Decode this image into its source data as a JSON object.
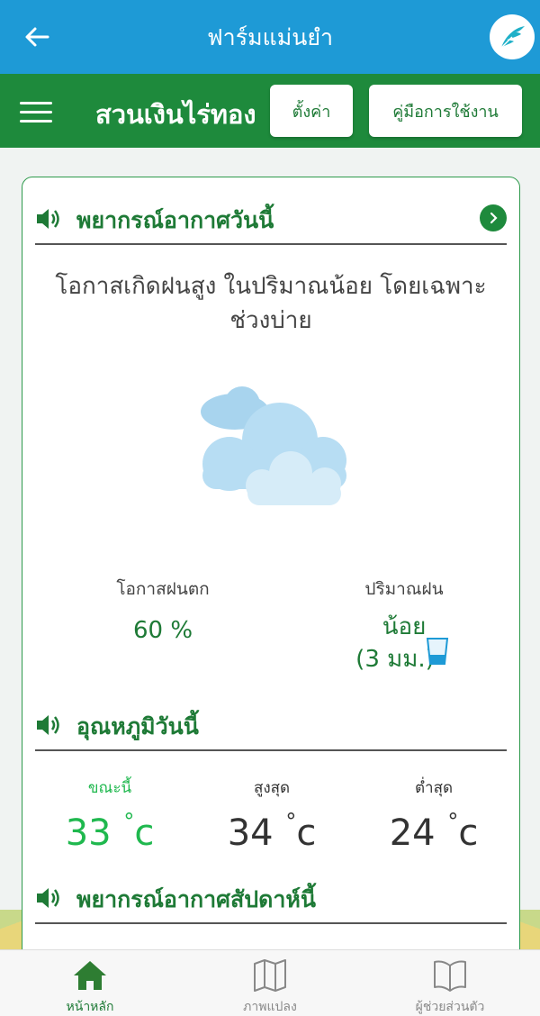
{
  "topbar": {
    "title": "ฟาร์มแม่นยำ",
    "back_icon": "arrow-left-icon",
    "logo_icon": "feather-logo-icon"
  },
  "farm_bar": {
    "name": "สวนเงินไร่ทอง",
    "settings_label": "ตั้งค่า",
    "manual_label": "คู่มือการใช้งาน"
  },
  "today_weather": {
    "title": "พยากรณ์อากาศวันนี้",
    "description": "โอกาสเกิดฝนสูง ในปริมาณน้อย โดยเฉพาะช่วงบ่าย",
    "rain_chance_label": "โอกาสฝนตก",
    "rain_chance_value": "60 %",
    "rain_amount_label": "ปริมาณฝน",
    "rain_amount_value": "น้อย",
    "rain_amount_detail": "(3 มม.)"
  },
  "temperature": {
    "title": "อุณหภูมิวันนี้",
    "now_label": "ขณะนี้",
    "now_value": "33",
    "max_label": "สูงสุด",
    "max_value": "34",
    "min_label": "ต่ำสุด",
    "min_value": "24",
    "unit": "c"
  },
  "weekly": {
    "title": "พยากรณ์อากาศสัปดาห์นี้"
  },
  "bottom_nav": [
    {
      "label": "หน้าหลัก",
      "icon": "home-icon"
    },
    {
      "label": "ภาพแปลง",
      "icon": "map-icon"
    },
    {
      "label": "ผู้ช่วยส่วนตัว",
      "icon": "book-icon"
    }
  ],
  "colors": {
    "top_blue": "#1e9ad6",
    "farm_green": "#1e8a3c",
    "accent_green": "#1fb84e"
  }
}
